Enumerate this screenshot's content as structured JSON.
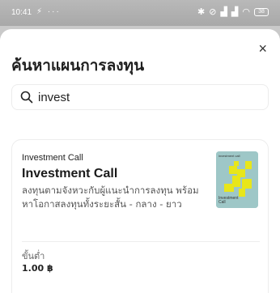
{
  "status_bar": {
    "time": "10:41",
    "left_icons": "⚡ ···",
    "right_icons": [
      "bluetooth-icon",
      "mute-icon",
      "signal-icon",
      "signal-icon",
      "wifi-icon"
    ],
    "battery": "38"
  },
  "sheet": {
    "title": "ค้นหาแผนการลงทุน",
    "close_label": "×",
    "search": {
      "value": "invest",
      "placeholder": ""
    }
  },
  "result": {
    "eyebrow": "Investment Call",
    "name": "Investment Call",
    "description": "ลงทุนตามจังหวะกับผู้แนะนำการลงทุน พร้อมหาโอกาสลงทุนทั้งระยะสั้น - กลาง - ยาว",
    "thumbnail": {
      "top_text": "investment call",
      "bottom_text": "Investment Call",
      "bg_color": "#9ec7c7",
      "accent_color": "#e8e61a"
    },
    "minimum_label": "ขั้นต่ำ",
    "minimum_value": "1.00 ฿"
  }
}
